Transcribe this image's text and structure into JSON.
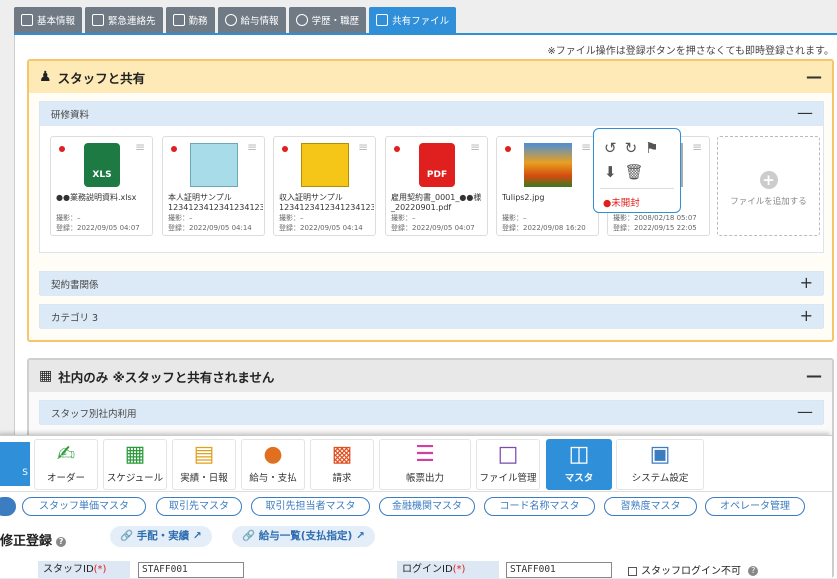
{
  "tabs": [
    {
      "label": "基本情報",
      "active": false
    },
    {
      "label": "緊急連絡先",
      "active": false
    },
    {
      "label": "勤務",
      "active": false
    },
    {
      "label": "給与情報",
      "active": false
    },
    {
      "label": "学歴・職歴",
      "active": false
    },
    {
      "label": "共有ファイル",
      "active": true
    }
  ],
  "note": "※ファイル操作は登録ボタンを押さなくても即時登録されます。",
  "staff_section": {
    "title": "スタッフと共有",
    "collapse_icon": "minus-icon",
    "subsections": [
      {
        "title": "研修資料",
        "expanded": true
      },
      {
        "title": "契約書関係",
        "expanded": false
      },
      {
        "title": "カテゴリ 3",
        "expanded": false
      }
    ]
  },
  "files": [
    {
      "name": "●●業務説明資料.xlsx",
      "shot": "撮影：–",
      "reg": "登録：2022/09/05 04:07",
      "thumb": "xls",
      "thumb_label": "XLS"
    },
    {
      "name": "本人証明サンプル1234123412341234123…",
      "shot": "撮影：–",
      "reg": "登録：2022/09/05 04:14",
      "thumb": "cyan-doc"
    },
    {
      "name": "収入証明サンプル1234123412341234123…",
      "shot": "撮影：–",
      "reg": "登録：2022/09/05 04:14",
      "thumb": "yellow-doc"
    },
    {
      "name": "雇用契約書_0001_●●様_20220901.pdf",
      "shot": "撮影：–",
      "reg": "登録：2022/09/05 04:07",
      "thumb": "pdf",
      "thumb_label": "PDF"
    },
    {
      "name": "Tulips2.jpg",
      "shot": "撮影：–",
      "reg": "登録：2022/09/08 16:20",
      "thumb": "photo"
    },
    {
      "name": "",
      "shot": "撮影：2008/02/18 05:07",
      "reg": "登録：2022/09/15 22:05",
      "thumb": "photo2"
    }
  ],
  "add_file_label": "ファイルを追加する",
  "popup": {
    "unread_label": "●未開封"
  },
  "internal_section": {
    "title": "社内のみ ※スタッフと共有されません",
    "subsection": "スタッフ別社内利用"
  },
  "nav": [
    {
      "label": "オーダー",
      "icon": "handshake-icon"
    },
    {
      "label": "スケジュール",
      "icon": "calendar-icon"
    },
    {
      "label": "実績・日報",
      "icon": "book-icon"
    },
    {
      "label": "給与・支払",
      "icon": "payment-icon"
    },
    {
      "label": "請求",
      "icon": "building-icon"
    },
    {
      "label": "帳票出力",
      "icon": "stack-icon"
    },
    {
      "label": "ファイル管理",
      "icon": "file-icon"
    },
    {
      "label": "マスタ",
      "icon": "database-icon",
      "active": true
    },
    {
      "label": "システム設定",
      "icon": "monitor-icon"
    }
  ],
  "nav_partial": "S",
  "pills": [
    "スタッフ単価マスタ",
    "取引先マスタ",
    "取引先担当者マスタ",
    "金融機関マスタ",
    "コード名称マスタ",
    "習熟度マスタ",
    "オペレータ管理"
  ],
  "page_title": "修正登録",
  "title_links": [
    "手配・実績",
    "給与一覧(支払指定)"
  ],
  "form": {
    "staff_id_label": "スタッフID",
    "staff_id_value": "STAFF001",
    "login_id_label": "ログインID",
    "login_id_value": "STAFF001",
    "required_mark": "(*)",
    "login_disabled_label": "スタッフログイン不可"
  }
}
